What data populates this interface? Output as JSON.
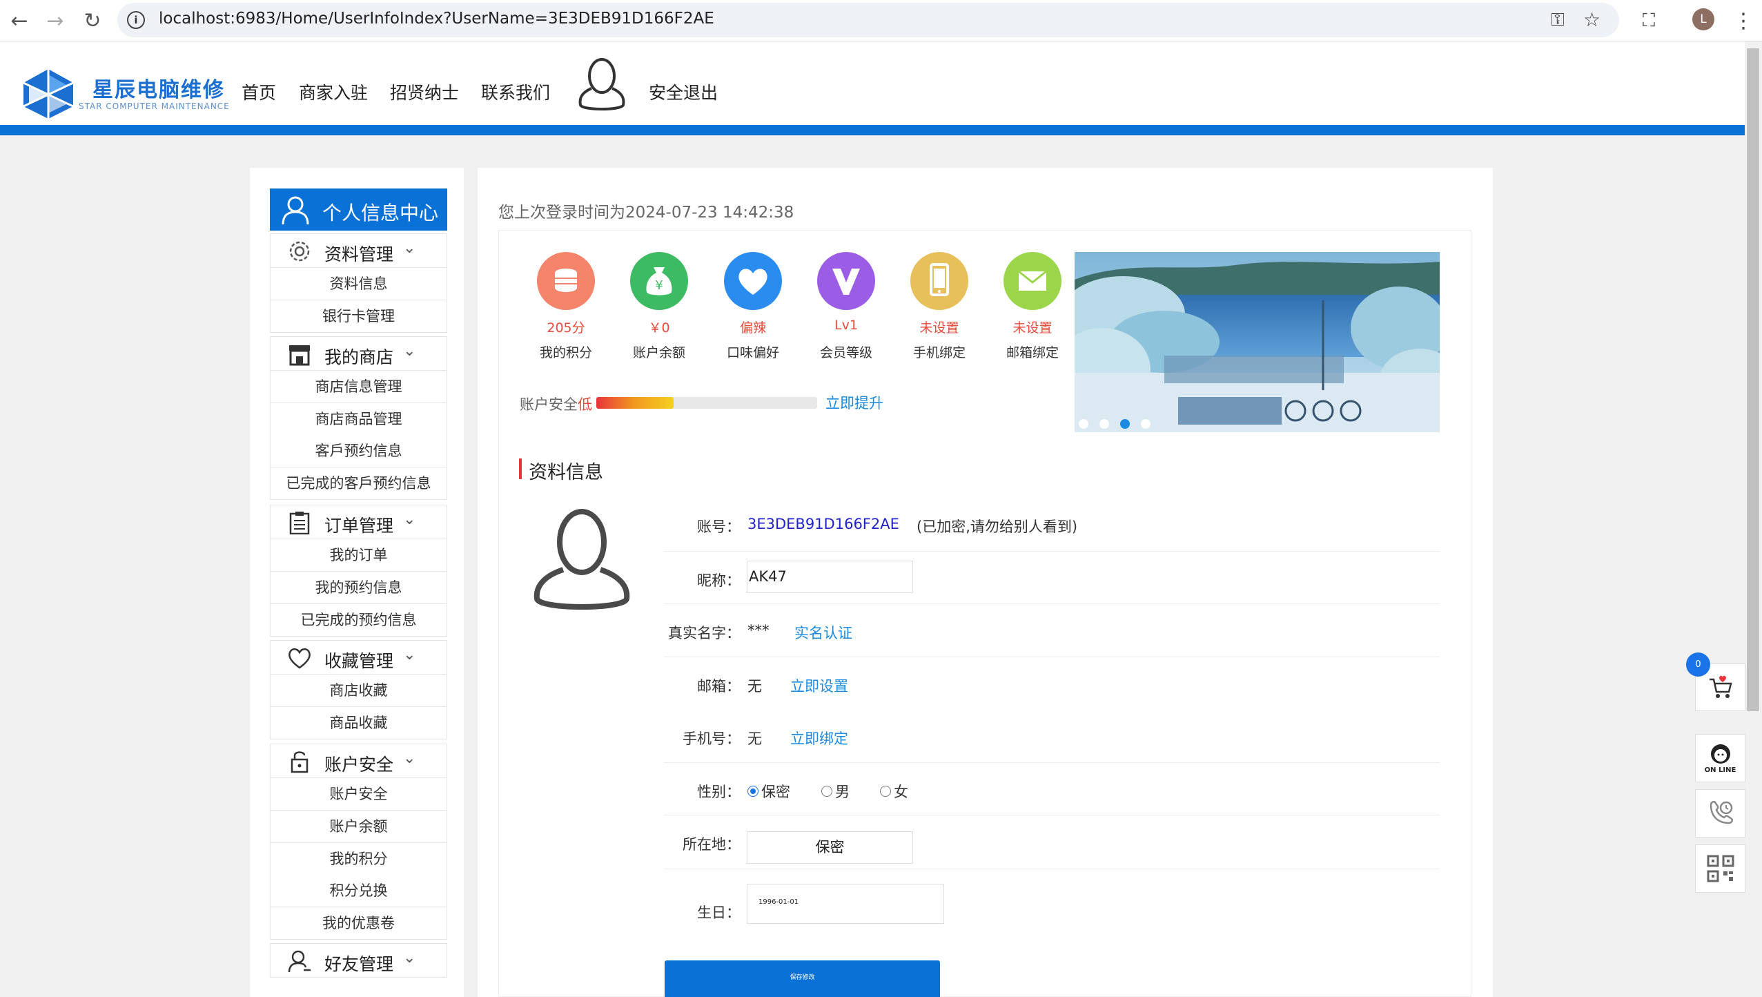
{
  "browser": {
    "url": "localhost:6983/Home/UserInfoIndex?UserName=3E3DEB91D166F2AE",
    "profile_initial": "L"
  },
  "site": {
    "logo_text": "星辰电脑维修",
    "logo_sub": "STAR COMPUTER MAINTENANCE",
    "nav": [
      "首页",
      "商家入驻",
      "招贤纳士",
      "联系我们"
    ],
    "logout": "安全退出"
  },
  "sidebar": {
    "header": "个人信息中心",
    "sections": [
      {
        "label": "资料管理",
        "icon": "gear-icon",
        "items": [
          "资料信息",
          "银行卡管理"
        ]
      },
      {
        "label": "我的商店",
        "icon": "store-icon",
        "items": [
          "商店信息管理",
          "商店商品管理",
          "客戶预约信息",
          "已完成的客戶预约信息"
        ]
      },
      {
        "label": "订单管理",
        "icon": "clipboard-icon",
        "items": [
          "我的订单",
          "我的预约信息",
          "已完成的预约信息"
        ]
      },
      {
        "label": "收藏管理",
        "icon": "heart-icon",
        "items": [
          "商店收藏",
          "商品收藏"
        ]
      },
      {
        "label": "账户安全",
        "icon": "lock-icon",
        "items": [
          "账户安全",
          "账户余额",
          "我的积分",
          "积分兑换",
          "我的优惠卷"
        ]
      },
      {
        "label": "好友管理",
        "icon": "user-icon",
        "items": []
      }
    ]
  },
  "main": {
    "last_login": "您上次登录时间为2024-07-23 14:42:38",
    "stats": [
      {
        "value": "205分",
        "label": "我的积分",
        "color": "#f4846a",
        "icon": "coins-icon"
      },
      {
        "value": "￥0",
        "label": "账户余额",
        "color": "#3dbb62",
        "icon": "moneybag-icon"
      },
      {
        "value": "偏辣",
        "label": "口味偏好",
        "color": "#2b8cf0",
        "icon": "heart-icon"
      },
      {
        "value": "Lv1",
        "label": "会员等级",
        "color": "#9b5de5",
        "icon": "vip-icon"
      },
      {
        "value": "未设置",
        "label": "手机绑定",
        "color": "#e8c05a",
        "icon": "phone-icon"
      },
      {
        "value": "未设置",
        "label": "邮箱绑定",
        "color": "#9bd64a",
        "icon": "mail-icon"
      }
    ],
    "security": {
      "label": "账户安全",
      "level": "低",
      "upgrade": "立即提升",
      "progress": 0.35
    },
    "carousel": {
      "dots": 4,
      "active": 2
    },
    "profile_title": "资料信息",
    "account": {
      "label": "账号：",
      "value": "3E3DEB91D166F2AE",
      "note": "(已加密,请勿给别人看到)"
    },
    "nickname": {
      "label": "昵称：",
      "value": "AK47"
    },
    "realname": {
      "label": "真实名字：",
      "value": "***",
      "action": "实名认证"
    },
    "email": {
      "label": "邮箱：",
      "value": "无",
      "action": "立即设置"
    },
    "phone": {
      "label": "手机号：",
      "value": "无",
      "action": "立即绑定"
    },
    "gender": {
      "label": "性别：",
      "options": [
        "保密",
        "男",
        "女"
      ],
      "selected": 0
    },
    "location": {
      "label": "所在地：",
      "value": "保密"
    },
    "birthday": {
      "label": "生日：",
      "value": "1996-01-01"
    },
    "save": "保存修改"
  },
  "floating": {
    "cart_count": "0",
    "online": "ON LINE"
  }
}
